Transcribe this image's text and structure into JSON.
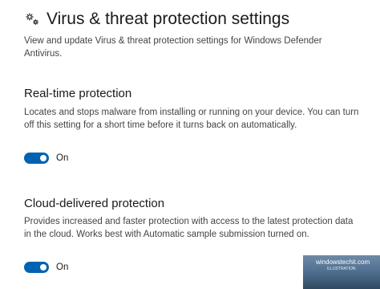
{
  "header": {
    "title": "Virus & threat protection settings",
    "icon": "gear-icon",
    "description": "View and update Virus & threat protection settings for Windows Defender Antivirus."
  },
  "sections": [
    {
      "title": "Real-time protection",
      "description": "Locates and stops malware from installing or running on your device. You can turn off this setting for a short time before it turns back on automatically.",
      "toggle_state": "On",
      "toggle_on": true
    },
    {
      "title": "Cloud-delivered protection",
      "description": "Provides increased and faster protection with access to the latest protection data in the cloud.  Works best with Automatic sample submission turned on.",
      "toggle_state": "On",
      "toggle_on": true
    }
  ],
  "watermark": {
    "text": "windowstechit.com",
    "subtext": "ILLUSTRATION"
  },
  "colors": {
    "toggle_on": "#0063b1",
    "background": "#ffffff",
    "text_primary": "#1a1a1a",
    "text_secondary": "#444444"
  }
}
